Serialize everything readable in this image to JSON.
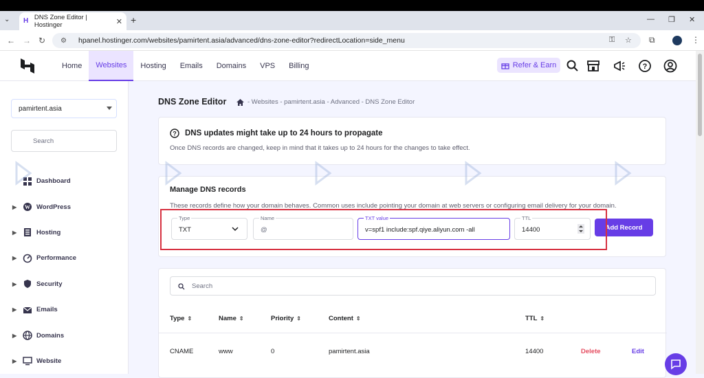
{
  "browser": {
    "tab_title": "DNS Zone Editor | Hostinger",
    "url": "hpanel.hostinger.com/websites/pamirtent.asia/advanced/dns-zone-editor?redirectLocation=side_menu"
  },
  "header": {
    "nav": [
      {
        "label": "Home",
        "active": false
      },
      {
        "label": "Websites",
        "active": true
      },
      {
        "label": "Hosting",
        "active": false
      },
      {
        "label": "Emails",
        "active": false
      },
      {
        "label": "Domains",
        "active": false
      },
      {
        "label": "VPS",
        "active": false
      },
      {
        "label": "Billing",
        "active": false
      }
    ],
    "refer_label": "Refer & Earn"
  },
  "sidebar": {
    "domain_select": "pamirtent.asia",
    "search_placeholder": "Search",
    "items": [
      {
        "label": "Dashboard",
        "icon": "dashboard-icon",
        "expandable": false
      },
      {
        "label": "WordPress",
        "icon": "wordpress-icon",
        "expandable": true
      },
      {
        "label": "Hosting",
        "icon": "hosting-icon",
        "expandable": true
      },
      {
        "label": "Performance",
        "icon": "performance-icon",
        "expandable": true
      },
      {
        "label": "Security",
        "icon": "shield-icon",
        "expandable": true
      },
      {
        "label": "Emails",
        "icon": "mail-icon",
        "expandable": true
      },
      {
        "label": "Domains",
        "icon": "globe-icon",
        "expandable": true
      },
      {
        "label": "Website",
        "icon": "monitor-icon",
        "expandable": true
      }
    ]
  },
  "page": {
    "title": "DNS Zone Editor",
    "breadcrumb": "- Websites - pamirtent.asia - Advanced - DNS Zone Editor"
  },
  "notice": {
    "heading": "DNS updates might take up to 24 hours to propagate",
    "text": "Once DNS records are changed, keep in mind that it takes up to 24 hours for the changes to take effect."
  },
  "manage": {
    "heading": "Manage DNS records",
    "text": "These records define how your domain behaves. Common uses include pointing your domain at web servers or configuring email delivery for your domain.",
    "type_label": "Type",
    "type_value": "TXT",
    "name_label": "Name",
    "name_value": "@",
    "txt_label": "TXT value",
    "txt_value": "v=spf1 include:spf.qiye.aliyun.com -all",
    "ttl_label": "TTL",
    "ttl_value": "14400",
    "add_button": "Add Record"
  },
  "records": {
    "search_placeholder": "Search",
    "columns": [
      "Type",
      "Name",
      "Priority",
      "Content",
      "TTL"
    ],
    "rows": [
      {
        "type": "CNAME",
        "name": "www",
        "priority": "0",
        "content": "pamirtent.asia",
        "ttl": "14400",
        "delete": "Delete",
        "edit": "Edit"
      }
    ]
  },
  "colors": {
    "accent": "#673de6",
    "danger": "#e54d60",
    "highlight_box": "#d63040"
  }
}
